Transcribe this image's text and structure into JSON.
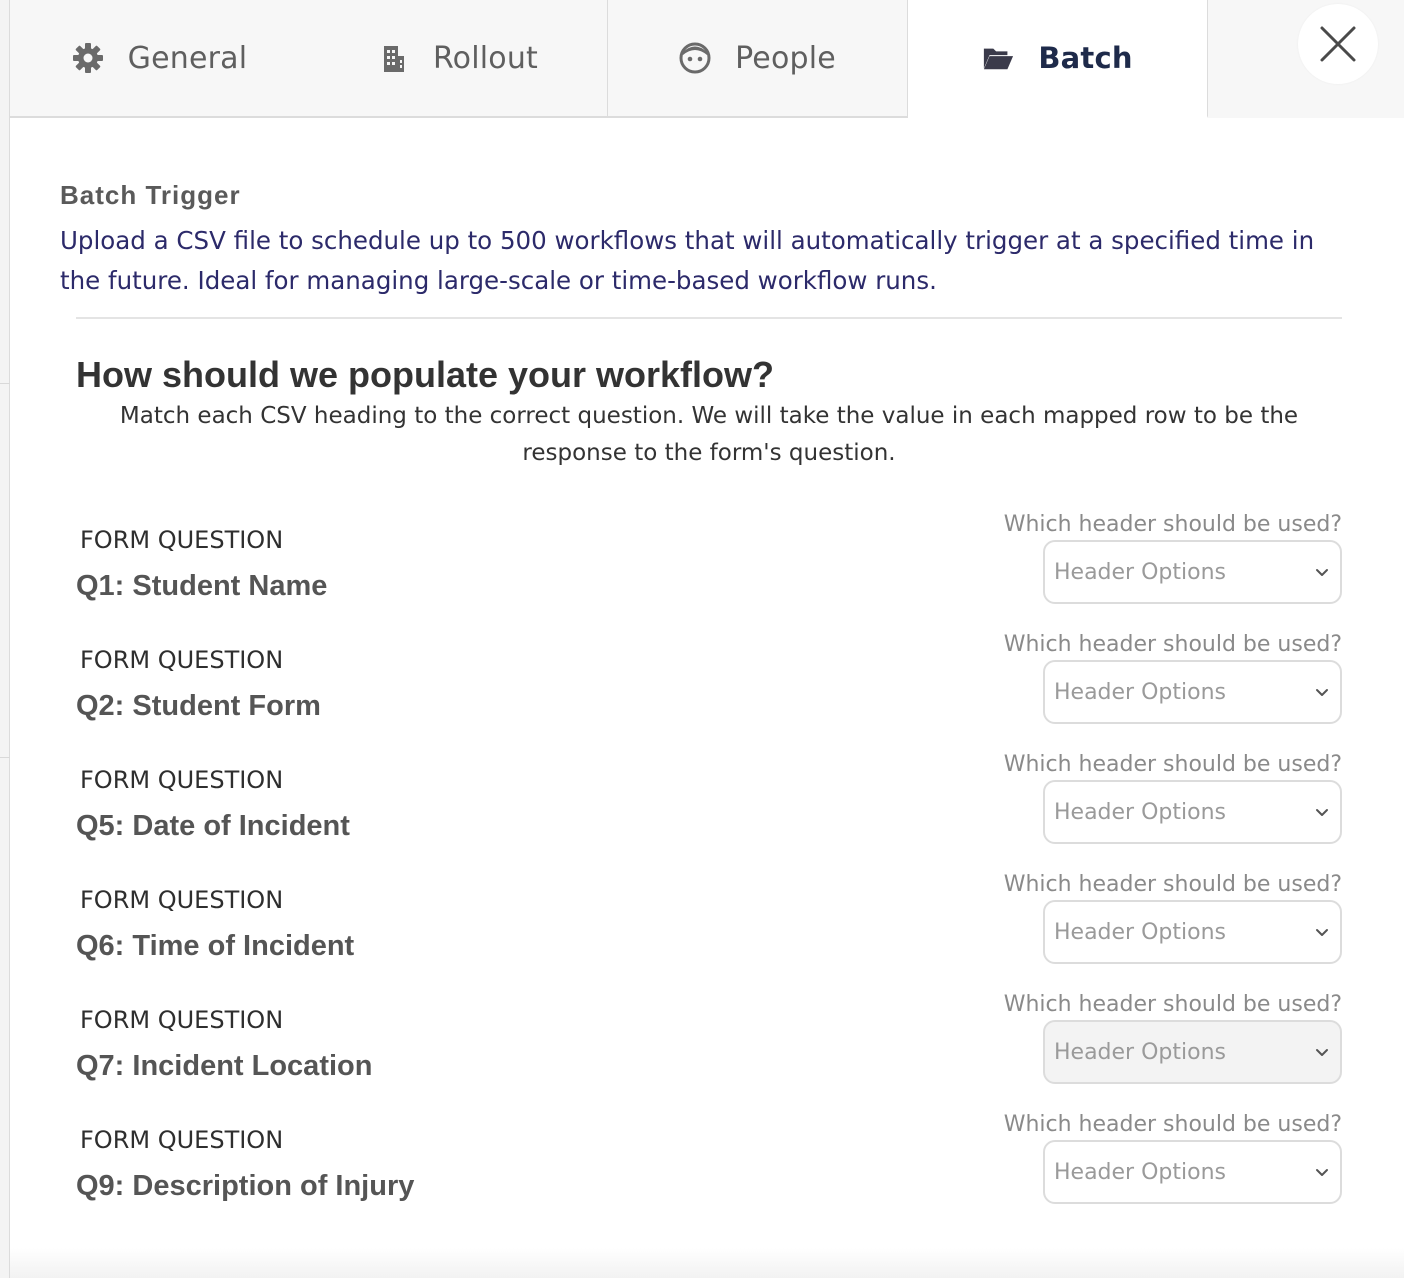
{
  "tabs": [
    {
      "label": "General",
      "icon": "gear-icon"
    },
    {
      "label": "Rollout",
      "icon": "building-icon"
    },
    {
      "label": "People",
      "icon": "face-icon"
    },
    {
      "label": "Batch",
      "icon": "folder-open-icon",
      "active": true
    }
  ],
  "close": {
    "icon": "close-icon"
  },
  "batch": {
    "title": "Batch Trigger",
    "description": "Upload a CSV file to schedule up to 500 workflows that will automatically trigger at a specified time in the future. Ideal for managing large-scale or time-based workflow runs."
  },
  "mapping": {
    "title": "How should we populate your workflow?",
    "subtitle": "Match each CSV heading to the correct question. We will take the value in each mapped row to be the response to the form's question.",
    "rows": [
      {
        "label": "FORM QUESTION",
        "question": "Q1: Student Name",
        "header_prompt": "Which header should be used?",
        "select_value": "Header Options"
      },
      {
        "label": "FORM QUESTION",
        "question": "Q2: Student Form",
        "header_prompt": "Which header should be used?",
        "select_value": "Header Options"
      },
      {
        "label": "FORM QUESTION",
        "question": "Q5: Date of Incident",
        "header_prompt": "Which header should be used?",
        "select_value": "Header Options"
      },
      {
        "label": "FORM QUESTION",
        "question": "Q6: Time of Incident",
        "header_prompt": "Which header should be used?",
        "select_value": "Header Options"
      },
      {
        "label": "FORM QUESTION",
        "question": "Q7: Incident Location",
        "header_prompt": "Which header should be used?",
        "select_value": "Header Options"
      },
      {
        "label": "FORM QUESTION",
        "question": "Q9: Description of Injury",
        "header_prompt": "Which header should be used?",
        "select_value": "Header Options"
      }
    ]
  },
  "colors": {
    "accent_text": "#2c2a6a",
    "active_tab_text": "#1e2a4a",
    "tab_bg": "#f7f7f7"
  }
}
